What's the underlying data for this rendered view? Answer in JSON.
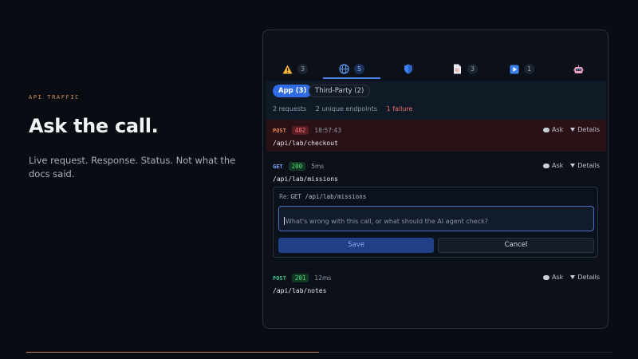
{
  "hero": {
    "eyebrow": "API TRAFFIC",
    "title": "Ask the call.",
    "subtitle": "Live request. Response. Status. Not what the docs said."
  },
  "progress": {
    "fraction": 0.5
  },
  "tabs": [
    {
      "icon": "warning-icon",
      "count": "3",
      "active": false
    },
    {
      "icon": "globe-icon",
      "count": "5",
      "active": true
    },
    {
      "icon": "shield-icon",
      "count": "",
      "active": false
    },
    {
      "icon": "document-icon",
      "count": "3",
      "active": false
    },
    {
      "icon": "play-icon",
      "count": "1",
      "active": false
    },
    {
      "icon": "robot-icon",
      "count": "",
      "active": false
    }
  ],
  "filters": {
    "app": "App (3)",
    "third_party": "Third-Party (2)"
  },
  "summary": {
    "requests": "2 requests",
    "endpoints": "2 unique endpoints",
    "failures": "1 failure"
  },
  "actions": {
    "ask": "Ask",
    "details": "Details"
  },
  "requests": [
    {
      "method": "POST",
      "status": "402",
      "meta": "18:57:43",
      "path": "/api/lab/checkout",
      "error": true
    },
    {
      "method": "GET",
      "status": "200",
      "meta": "5ms",
      "path": "/api/lab/missions",
      "error": false
    },
    {
      "method": "POST",
      "status": "201",
      "meta": "12ms",
      "path": "/api/lab/notes",
      "error": false
    }
  ],
  "ask_box": {
    "prefix": "Re: ",
    "target": "GET /api/lab/missions",
    "placeholder": "What's wrong with this call, or what should the AI agent check?",
    "save": "Save",
    "cancel": "Cancel"
  },
  "colors": {
    "accent": "#2f6ce3",
    "error": "#ef6b6b",
    "success": "#55d67e",
    "eyebrow": "#d7935a"
  }
}
